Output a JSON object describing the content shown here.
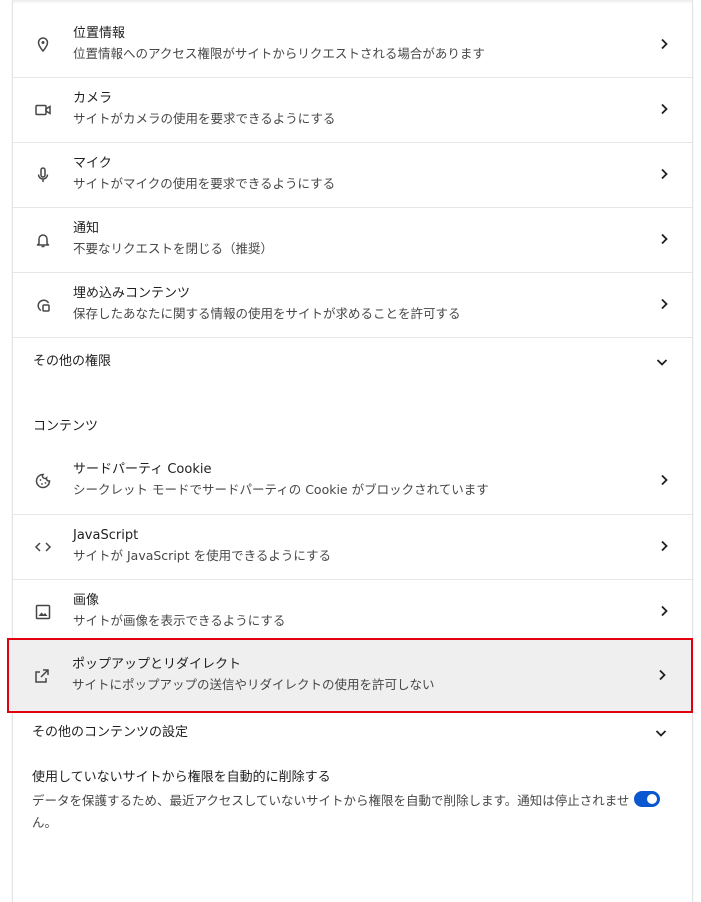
{
  "permissions": [
    {
      "title": "位置情報",
      "subtitle": "位置情報へのアクセス権限がサイトからリクエストされる場合があります",
      "icon": "location-pin-icon"
    },
    {
      "title": "カメラ",
      "subtitle": "サイトがカメラの使用を要求できるようにする",
      "icon": "camera-icon"
    },
    {
      "title": "マイク",
      "subtitle": "サイトがマイクの使用を要求できるようにする",
      "icon": "microphone-icon"
    },
    {
      "title": "通知",
      "subtitle": "不要なリクエストを閉じる（推奨）",
      "icon": "bell-icon"
    },
    {
      "title": "埋め込みコンテンツ",
      "subtitle": "保存したあなたに関する情報の使用をサイトが求めることを許可する",
      "icon": "embedded-content-icon"
    }
  ],
  "other_permissions_label": "その他の権限",
  "content_section_label": "コンテンツ",
  "content": [
    {
      "title": "サードパーティ Cookie",
      "subtitle": "シークレット モードでサードパーティの Cookie がブロックされています",
      "icon": "cookie-icon"
    },
    {
      "title": "JavaScript",
      "subtitle": "サイトが JavaScript を使用できるようにする",
      "icon": "code-brackets-icon"
    },
    {
      "title": "画像",
      "subtitle": "サイトが画像を表示できるようにする",
      "icon": "image-icon"
    },
    {
      "title": "ポップアップとリダイレクト",
      "subtitle": "サイトにポップアップの送信やリダイレクトの使用を許可しない",
      "icon": "open-in-new-icon"
    }
  ],
  "other_content_label": "その他のコンテンツの設定",
  "auto_remove": {
    "title": "使用していないサイトから権限を自動的に削除する",
    "subtitle": "データを保護するため、最近アクセスしていないサイトから権限を自動で削除します。通知は停止されません。",
    "enabled": true
  },
  "colors": {
    "accent": "#0b57d0",
    "highlight_border": "#e0000e",
    "highlight_bg": "#efefef"
  }
}
